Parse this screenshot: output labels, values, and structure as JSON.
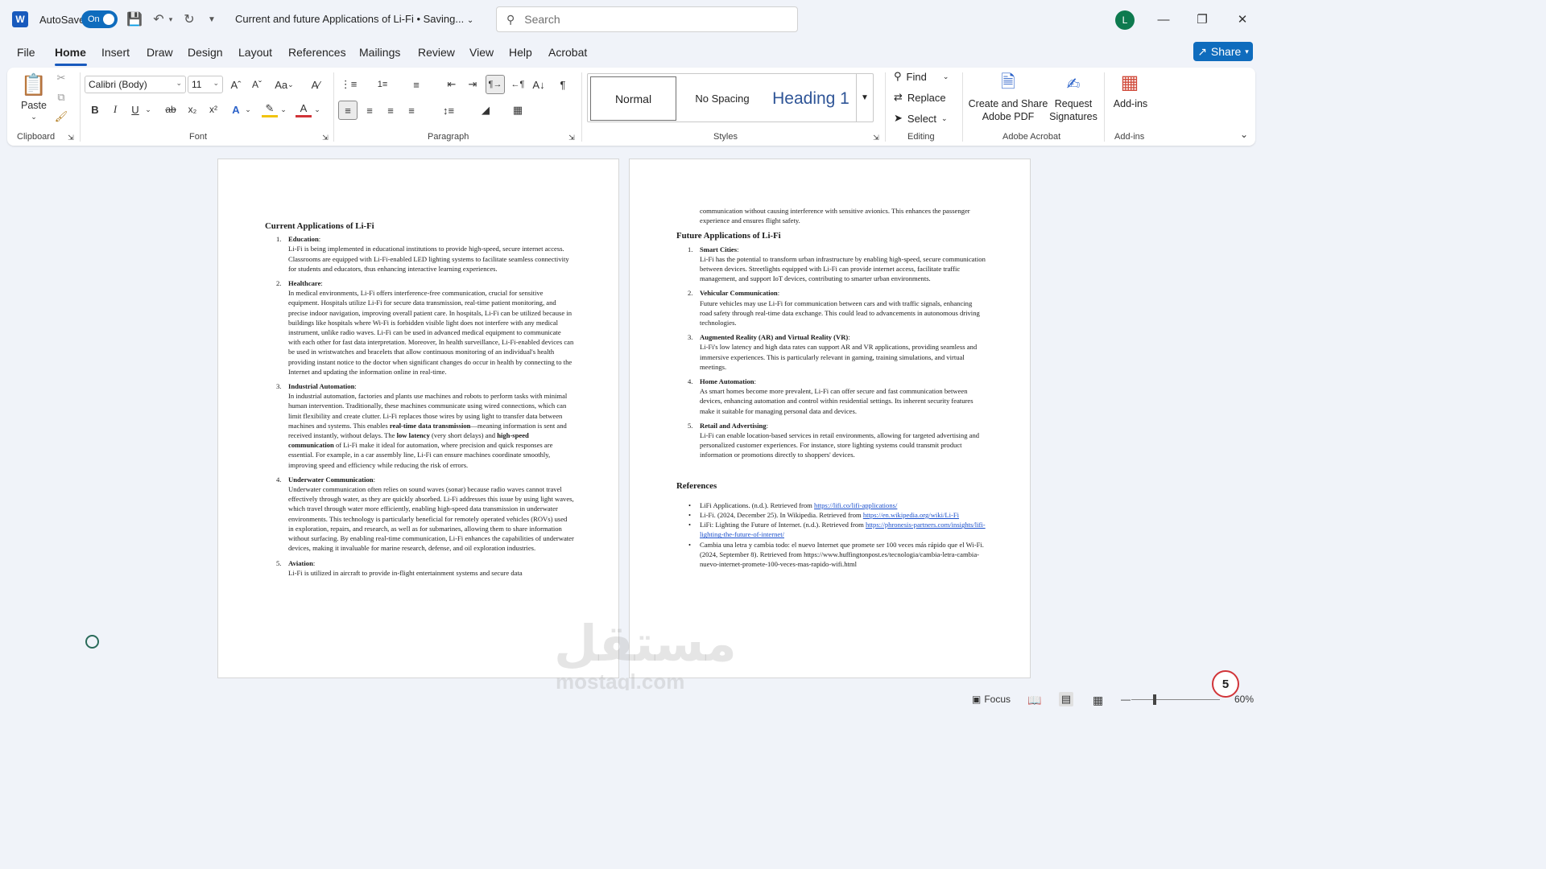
{
  "app": {
    "logo": "W",
    "autosave_label": "AutoSave",
    "autosave_state": "On",
    "doc_title": "Current and future Applications of Li-Fi  •  Saving...",
    "search_placeholder": "Search",
    "avatar_initial": "L"
  },
  "tabs": [
    "File",
    "Home",
    "Insert",
    "Draw",
    "Design",
    "Layout",
    "References",
    "Mailings",
    "Review",
    "View",
    "Help",
    "Acrobat"
  ],
  "share_label": "Share",
  "ribbon": {
    "clipboard": {
      "paste": "Paste",
      "label": "Clipboard"
    },
    "font": {
      "family": "Calibri (Body)",
      "size": "11",
      "label": "Font",
      "case_btn": "Aa"
    },
    "paragraph": {
      "label": "Paragraph"
    },
    "styles": {
      "normal": "Normal",
      "no_spacing": "No Spacing",
      "heading1": "Heading 1",
      "label": "Styles"
    },
    "editing": {
      "find": "Find",
      "replace": "Replace",
      "select": "Select",
      "label": "Editing"
    },
    "acrobat": {
      "create": "Create and Share\nAdobe PDF",
      "request": "Request\nSignatures",
      "label": "Adobe Acrobat"
    },
    "addins": {
      "button": "Add-ins",
      "label": "Add-ins"
    }
  },
  "page1": {
    "heading": "Current Applications of Li-Fi",
    "items": [
      {
        "num": "1.",
        "title": "Education",
        "text": "Li-Fi is being implemented in educational institutions to provide high-speed, secure internet access. Classrooms are equipped with Li-Fi-enabled LED lighting systems to facilitate seamless connectivity for students and educators, thus enhancing interactive learning experiences."
      },
      {
        "num": "2.",
        "title": "Healthcare",
        "text": "In medical environments, Li-Fi offers interference-free communication, crucial for sensitive equipment. Hospitals utilize Li-Fi for secure data transmission, real-time patient monitoring, and precise indoor navigation, improving overall patient care. In hospitals, Li-Fi can be utilized because in buildings like hospitals where Wi-Fi is forbidden visible light does not interfere with any medical instrument, unlike radio waves. Li-Fi can be used in advanced medical equipment to communicate with each other for fast data interpretation. Moreover, In health surveillance, Li-Fi-enabled devices can be used in wristwatches and bracelets that allow continuous monitoring of an individual's health providing instant notice to the doctor when significant changes do occur in health by connecting to the Internet and updating the information online in real-time."
      },
      {
        "num": "3.",
        "title": "Industrial Automation",
        "text_a": "In industrial automation, factories and plants use machines and robots to perform tasks with minimal human intervention. Traditionally, these machines communicate using wired connections, which can limit flexibility and create clutter. Li-Fi replaces those wires by using light to transfer data between machines and systems. This enables ",
        "bold_a": "real-time data transmission",
        "text_b": "—meaning information is sent and received instantly, without delays. The ",
        "bold_b": "low latency",
        "text_c": " (very short delays) and ",
        "bold_c": "high-speed communication",
        "text_d": " of Li-Fi make it ideal for automation, where precision and quick responses are essential. For example, in a car assembly line, Li-Fi can ensure machines coordinate smoothly, improving speed and efficiency while reducing the risk of errors."
      },
      {
        "num": "4.",
        "title": "Underwater Communication",
        "text": "Underwater communication often relies on sound waves (sonar) because radio waves cannot travel effectively through water, as they are quickly absorbed. Li-Fi addresses this issue by using light waves, which travel through water more efficiently, enabling high-speed data transmission in underwater environments. This technology is particularly beneficial for remotely operated vehicles (ROVs) used in exploration, repairs, and research, as well as for submarines, allowing them to share information without surfacing. By enabling real-time communication, Li-Fi enhances the capabilities of underwater devices, making it invaluable for marine research, defense, and oil exploration industries."
      },
      {
        "num": "5.",
        "title": "Aviation",
        "text": "Li-Fi is utilized in aircraft to provide in-flight entertainment systems and secure data"
      }
    ]
  },
  "page2": {
    "continuation": "communication without causing interference with sensitive avionics. This enhances the passenger experience and ensures flight safety.",
    "heading": "Future Applications of Li-Fi",
    "items": [
      {
        "num": "1.",
        "title": "Smart Cities",
        "text": "Li-Fi has the potential to transform urban infrastructure by enabling high-speed, secure communication between devices. Streetlights equipped with Li-Fi can provide internet access, facilitate traffic management, and support IoT devices, contributing to smarter urban environments."
      },
      {
        "num": "2.",
        "title": "Vehicular Communication",
        "text": "Future vehicles may use Li-Fi for communication between cars and with traffic signals, enhancing road safety through real-time data exchange. This could lead to advancements in autonomous driving technologies."
      },
      {
        "num": "3.",
        "title": "Augmented Reality (AR) and Virtual Reality (VR)",
        "text": "Li-Fi's low latency and high data rates can support AR and VR applications, providing seamless and immersive experiences. This is particularly relevant in gaming, training simulations, and virtual meetings."
      },
      {
        "num": "4.",
        "title": "Home Automation",
        "text": "As smart homes become more prevalent, Li-Fi can offer secure and fast communication between devices, enhancing automation and control within residential settings. Its inherent security features make it suitable for managing personal data and devices."
      },
      {
        "num": "5.",
        "title": "Retail and Advertising",
        "text": "Li-Fi can enable location-based services in retail environments, allowing for targeted advertising and personalized customer experiences. For instance, store lighting systems could transmit product information or promotions directly to shoppers' devices."
      }
    ],
    "references_heading": "References",
    "references": [
      {
        "text": "LiFi Applications. (n.d.). Retrieved from ",
        "link": "https://lifi.co/lifi-applications/"
      },
      {
        "text": "Li-Fi. (2024, December 25). In Wikipedia. Retrieved from ",
        "link": "https://en.wikipedia.org/wiki/Li-Fi"
      },
      {
        "text": "LiFi: Lighting the Future of Internet. (n.d.). Retrieved from ",
        "link": "https://phronesis-partners.com/insights/lifi-lighting-the-future-of-internet/"
      },
      {
        "text": "Cambia una letra y cambia todo: el nuevo Internet que promete ser 100 veces más rápido que el Wi-Fi. (2024, September 8). Retrieved from https://www.huffingtonpost.es/tecnologia/cambia-letra-cambia-nuevo-internet-promete-100-veces-mas-rapido-wifi.html",
        "link": ""
      }
    ]
  },
  "statusbar": {
    "focus": "Focus",
    "zoom": "60%"
  },
  "badge": "5",
  "watermark": {
    "arabic": "مستقل",
    "latin": "mostaql.com"
  }
}
